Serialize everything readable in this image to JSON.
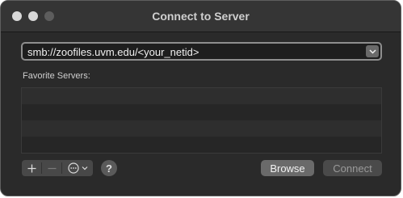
{
  "window": {
    "title": "Connect to Server"
  },
  "address": {
    "value": "smb://zoofiles.uvm.edu/<your_netid>"
  },
  "favorites": {
    "label": "Favorite Servers:",
    "rows": [
      "",
      "",
      "",
      ""
    ]
  },
  "toolbar": {
    "add_icon": "plus-icon",
    "remove_icon": "minus-icon",
    "more_icon": "ellipsis-circle-icon",
    "help_label": "?"
  },
  "buttons": {
    "browse_label": "Browse",
    "connect_label": "Connect"
  },
  "colors": {
    "window_bg": "#2a2a2a",
    "titlebar_bg": "#353535",
    "accent_border": "#8e8e8e"
  }
}
